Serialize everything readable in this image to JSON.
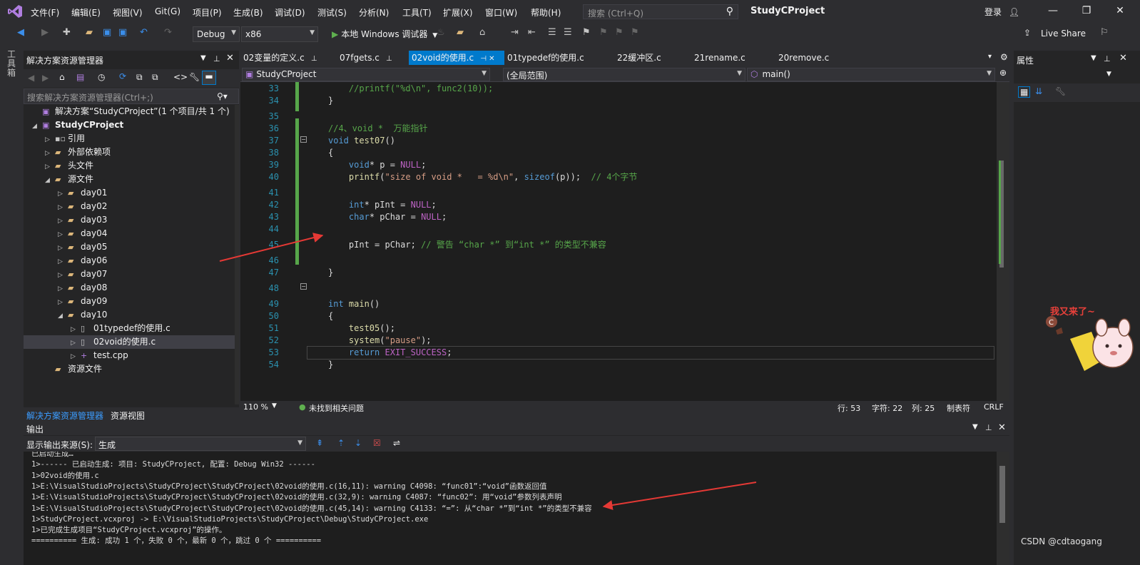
{
  "menu": {
    "items": [
      "文件(F)",
      "编辑(E)",
      "视图(V)",
      "Git(G)",
      "项目(P)",
      "生成(B)",
      "调试(D)",
      "测试(S)",
      "分析(N)",
      "工具(T)",
      "扩展(X)",
      "窗口(W)",
      "帮助(H)"
    ],
    "search_placeholder": "搜索 (Ctrl+Q)",
    "project_title": "StudyCProject",
    "login": "登录"
  },
  "toolbar": {
    "config": "Debug",
    "platform": "x86",
    "run_label": "本地 Windows 调试器",
    "live_share": "Live Share"
  },
  "left_strip_label": "工具箱",
  "solution_explorer": {
    "title": "解决方案资源管理器",
    "search_placeholder": "搜索解决方案资源管理器(Ctrl+;)",
    "tree": [
      {
        "label": "解决方案“StudyCProject”(1 个项目/共 1 个)",
        "indent": 0,
        "icon": "solution-icon",
        "expander": ""
      },
      {
        "label": "StudyCProject",
        "indent": 1,
        "icon": "project-icon",
        "expander": "open",
        "bold": true
      },
      {
        "label": "引用",
        "indent": 2,
        "icon": "references-icon",
        "expander": "closed"
      },
      {
        "label": "外部依赖项",
        "indent": 2,
        "icon": "folder-icon",
        "expander": "closed"
      },
      {
        "label": "头文件",
        "indent": 2,
        "icon": "folder-icon",
        "expander": "closed"
      },
      {
        "label": "源文件",
        "indent": 2,
        "icon": "folder-icon",
        "expander": "open"
      },
      {
        "label": "day01",
        "indent": 3,
        "icon": "folder-icon",
        "expander": "closed"
      },
      {
        "label": "day02",
        "indent": 3,
        "icon": "folder-icon",
        "expander": "closed"
      },
      {
        "label": "day03",
        "indent": 3,
        "icon": "folder-icon",
        "expander": "closed"
      },
      {
        "label": "day04",
        "indent": 3,
        "icon": "folder-icon",
        "expander": "closed"
      },
      {
        "label": "day05",
        "indent": 3,
        "icon": "folder-icon",
        "expander": "closed"
      },
      {
        "label": "day06",
        "indent": 3,
        "icon": "folder-icon",
        "expander": "closed"
      },
      {
        "label": "day07",
        "indent": 3,
        "icon": "folder-icon",
        "expander": "closed"
      },
      {
        "label": "day08",
        "indent": 3,
        "icon": "folder-icon",
        "expander": "closed"
      },
      {
        "label": "day09",
        "indent": 3,
        "icon": "folder-icon",
        "expander": "closed"
      },
      {
        "label": "day10",
        "indent": 3,
        "icon": "folder-icon",
        "expander": "open"
      },
      {
        "label": "01typedef的使用.c",
        "indent": 4,
        "icon": "c-file-icon",
        "expander": "closed"
      },
      {
        "label": "02void的使用.c",
        "indent": 4,
        "icon": "c-file-icon",
        "expander": "closed",
        "selected": true
      },
      {
        "label": "test.cpp",
        "indent": 4,
        "icon": "cpp-file-icon",
        "expander": "closed"
      },
      {
        "label": "资源文件",
        "indent": 2,
        "icon": "folder-icon",
        "expander": ""
      }
    ],
    "tabs": [
      "解决方案资源管理器",
      "资源视图"
    ]
  },
  "editor": {
    "tabs": [
      "02变量的定义.c",
      "07fgets.c",
      "02void的使用.c",
      "01typedef的使用.c",
      "22缓冲区.c",
      "21rename.c",
      "20remove.c"
    ],
    "active_tab": 2,
    "nav_project": "StudyCProject",
    "nav_scope": "(全局范围)",
    "nav_member": "main()",
    "lines": [
      {
        "n": "33",
        "html": "    <span class='cm'>//printf(\"%d\\n\", func2(10));</span>"
      },
      {
        "n": "34",
        "html": "}"
      },
      {
        "n": "35",
        "html": ""
      },
      {
        "n": "36",
        "html": "<span class='cm'>//4、void *  万能指针</span>"
      },
      {
        "n": "37",
        "html": "<span class='kw'>void</span> <span class='fn'>test07</span>()"
      },
      {
        "n": "38",
        "html": "{"
      },
      {
        "n": "39",
        "html": "    <span class='kw'>void</span>* p = <span class='mac'>NULL</span>;"
      },
      {
        "n": "40",
        "html": "    <span class='fn'>printf</span>(<span class='st'>\"size of void *   = %d\\n\"</span>, <span class='kw'>sizeof</span>(p));  <span class='cm'>// 4个字节</span>"
      },
      {
        "n": "41",
        "html": ""
      },
      {
        "n": "42",
        "html": "    <span class='kw'>int</span>* pInt = <span class='mac'>NULL</span>;"
      },
      {
        "n": "43",
        "html": "    <span class='kw'>char</span>* pChar = <span class='mac'>NULL</span>;"
      },
      {
        "n": "44",
        "html": ""
      },
      {
        "n": "45",
        "html": "    pInt = pChar; <span class='cm'>// 警告 “char *” 到“int *” 的类型不兼容</span>"
      },
      {
        "n": "46",
        "html": ""
      },
      {
        "n": "47",
        "html": "}"
      },
      {
        "n": "48",
        "html": ""
      },
      {
        "n": "49",
        "html": "<span class='kw'>int</span> <span class='fn'>main</span>()"
      },
      {
        "n": "50",
        "html": "{"
      },
      {
        "n": "51",
        "html": "    <span class='fn'>test05</span>();"
      },
      {
        "n": "52",
        "html": "    <span class='fn'>system</span>(<span class='st'>\"pause\"</span>);"
      },
      {
        "n": "53",
        "html": "    <span class='kw'>return</span> <span class='mac'>EXIT_SUCCESS</span>;"
      },
      {
        "n": "54",
        "html": "}"
      }
    ],
    "status": {
      "zoom": "110 %",
      "issues": "未找到相关问题",
      "row": "行: 53",
      "char": "字符: 22",
      "col": "列: 25",
      "tabs": "制表符",
      "eol": "CRLF"
    }
  },
  "output": {
    "title": "输出",
    "source_label": "显示输出来源(S):",
    "source_value": "生成",
    "lines": [
      "已启动生成…",
      "1>------ 已启动生成: 项目: StudyCProject, 配置: Debug Win32 ------",
      "1>02void的使用.c",
      "1>E:\\VisualStudioProjects\\StudyCProject\\StudyCProject\\02void的使用.c(16,11): warning C4098: “func01”:“void”函数返回值",
      "1>E:\\VisualStudioProjects\\StudyCProject\\StudyCProject\\02void的使用.c(32,9): warning C4087: “func02”: 用“void”参数列表声明",
      "1>E:\\VisualStudioProjects\\StudyCProject\\StudyCProject\\02void的使用.c(45,14): warning C4133: “=”: 从“char *”到“int *”的类型不兼容",
      "1>StudyCProject.vcxproj -> E:\\VisualStudioProjects\\StudyCProject\\Debug\\StudyCProject.exe",
      "1>已完成生成项目“StudyCProject.vcxproj”的操作。",
      "========== 生成: 成功 1 个，失败 0 个，最新 0 个，跳过 0 个 =========="
    ]
  },
  "properties": {
    "title": "属性"
  },
  "watermark": "CSDN @cdtaogang",
  "colors": {
    "accent": "#007acc",
    "keyword": "#569cd6",
    "comment": "#57a64a",
    "string": "#d69d85",
    "annotation_arrow": "#e53935"
  }
}
